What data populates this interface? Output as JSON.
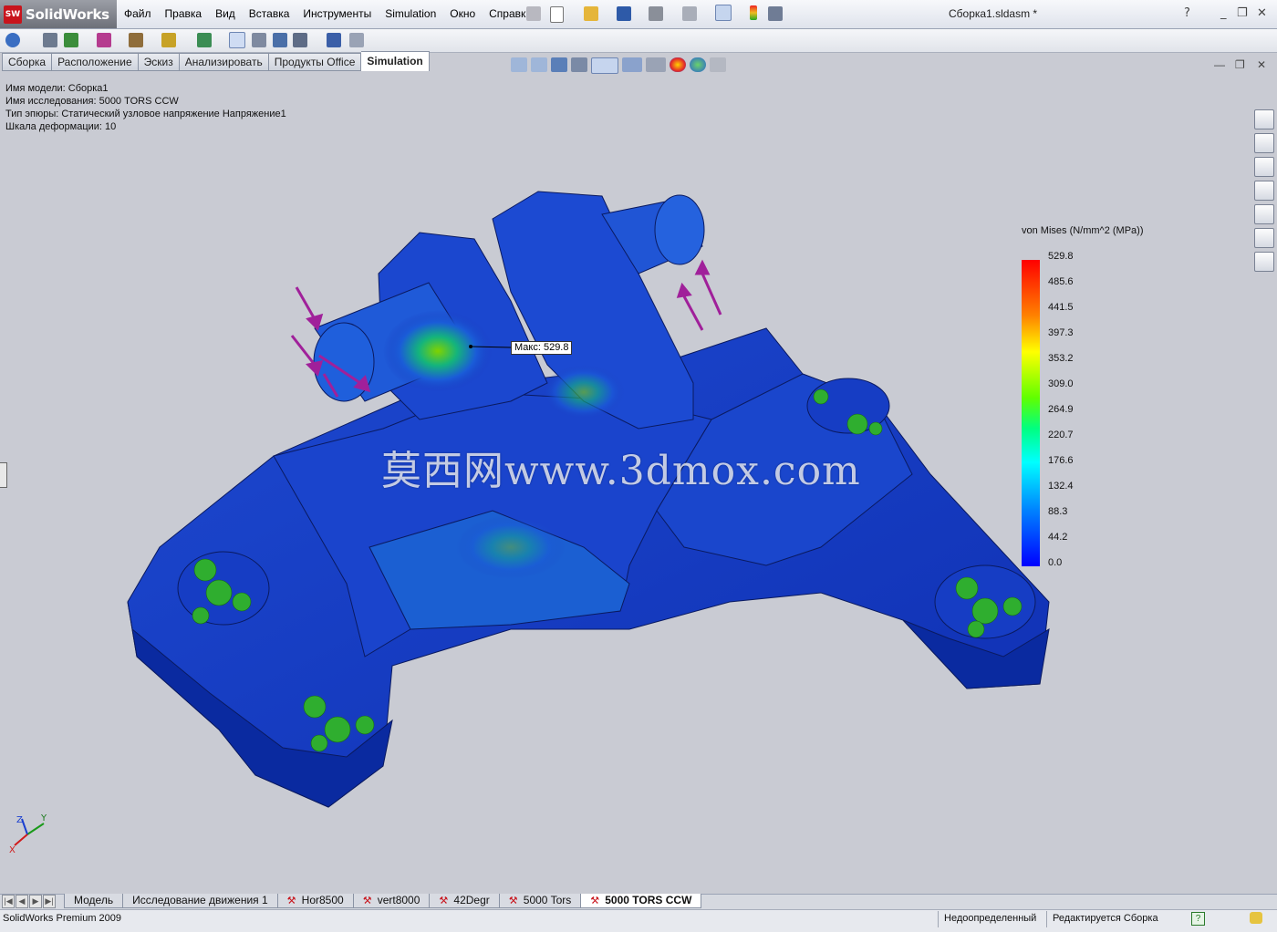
{
  "app": {
    "logo_text": "SolidWorks",
    "document_title": "Сборка1.sldasm *"
  },
  "menu": [
    "Файл",
    "Правка",
    "Вид",
    "Вставка",
    "Инструменты",
    "Simulation",
    "Окно",
    "Справка"
  ],
  "command_tabs": [
    {
      "label": "Сборка",
      "active": false
    },
    {
      "label": "Расположение",
      "active": false
    },
    {
      "label": "Эскиз",
      "active": false
    },
    {
      "label": "Анализировать",
      "active": false
    },
    {
      "label": "Продукты Office",
      "active": false
    },
    {
      "label": "Simulation",
      "active": true
    }
  ],
  "study_info": {
    "model_name": "Имя модели: Сборка1",
    "study_name": "Имя  исследования: 5000 TORS CCW",
    "plot_type": "Тип эпюры: Статический узловое напряжение Напряжение1",
    "deformation_scale": "Шкала деформации: 10"
  },
  "watermark": "莫西网www.3dmox.com",
  "max_label": "Макс: 529.8",
  "legend": {
    "title": "von Mises (N/mm^2 (MPa))",
    "ticks": [
      "529.8",
      "485.6",
      "441.5",
      "397.3",
      "353.2",
      "309.0",
      "264.9",
      "220.7",
      "176.6",
      "132.4",
      "88.3",
      "44.2",
      "0.0"
    ],
    "colors": {
      "max": "#ff0000",
      "min": "#0000ff"
    }
  },
  "triad": {
    "x": "X",
    "y": "Y",
    "z": "Z"
  },
  "bottom_tabs": [
    {
      "label": "Модель",
      "active": false,
      "study": false
    },
    {
      "label": "Исследование движения 1",
      "active": false,
      "study": false
    },
    {
      "label": "Hor8500",
      "active": false,
      "study": true
    },
    {
      "label": "vert8000",
      "active": false,
      "study": true
    },
    {
      "label": "42Degr",
      "active": false,
      "study": true
    },
    {
      "label": "5000 Tors",
      "active": false,
      "study": true
    },
    {
      "label": "5000 TORS CCW",
      "active": true,
      "study": true
    }
  ],
  "status": {
    "product": "SolidWorks Premium 2009",
    "definition": "Недоопределенный",
    "editing": "Редактируется Сборка"
  }
}
